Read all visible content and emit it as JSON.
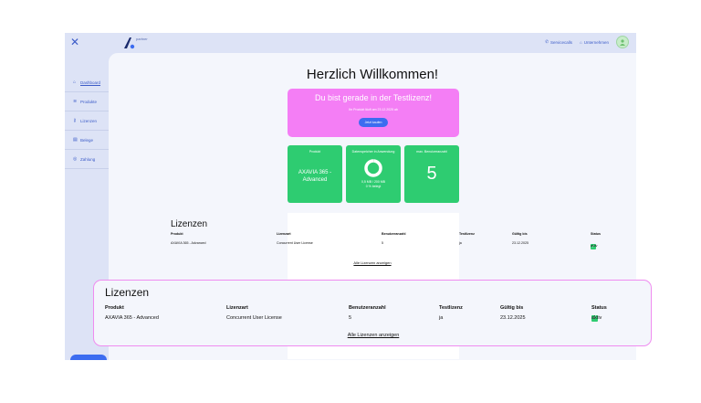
{
  "topbar": {
    "close_icon": "close-icon",
    "logo_text": "partner",
    "servicecalls": "Servicecalls",
    "unternehmen": "Unternehmen"
  },
  "sidebar": {
    "items": [
      {
        "label": "Dashboard",
        "icon": "home-icon"
      },
      {
        "label": "Produkte",
        "icon": "layers-icon"
      },
      {
        "label": "Lizenzen",
        "icon": "key-icon"
      },
      {
        "label": "Belege",
        "icon": "receipt-icon"
      },
      {
        "label": "Zahlung",
        "icon": "payment-icon"
      }
    ]
  },
  "main": {
    "welcome": "Herzlich Willkommen!",
    "trial": {
      "title": "Du bist gerade in der Testlizenz!",
      "subtitle": "Ihr Produkt läuft am 23.12.2025 ab",
      "button": "Jetzt kaufen"
    },
    "cards": [
      {
        "header": "Produkt",
        "value": "AXAVIA 365 - Advanced"
      },
      {
        "header": "Datenspeicher in Anwendung",
        "usage": "0,5 MB / 200 MB",
        "usage_pct": "0 % belegt",
        "fraction_used": 0.0025
      },
      {
        "header": "max. Benutzeranzahl",
        "value": "5"
      }
    ]
  },
  "licenses": {
    "title": "Lizenzen",
    "columns": [
      "Produkt",
      "Lizenzart",
      "Benutzeranzahl",
      "Testlizenz",
      "Gültig bis",
      "Status"
    ],
    "rows": [
      [
        "AXAVIA 365 - Advanced",
        "Concurrent User License",
        "5",
        "ja",
        "23.12.2025",
        "aktiv"
      ]
    ],
    "all_link": "Alle Lizenzen anzeigen"
  },
  "colors": {
    "accent": "#3c6cf0",
    "trial_bg": "#f47ef5",
    "card_bg": "#2ecc71",
    "highlight_border": "#ef8cf0"
  }
}
